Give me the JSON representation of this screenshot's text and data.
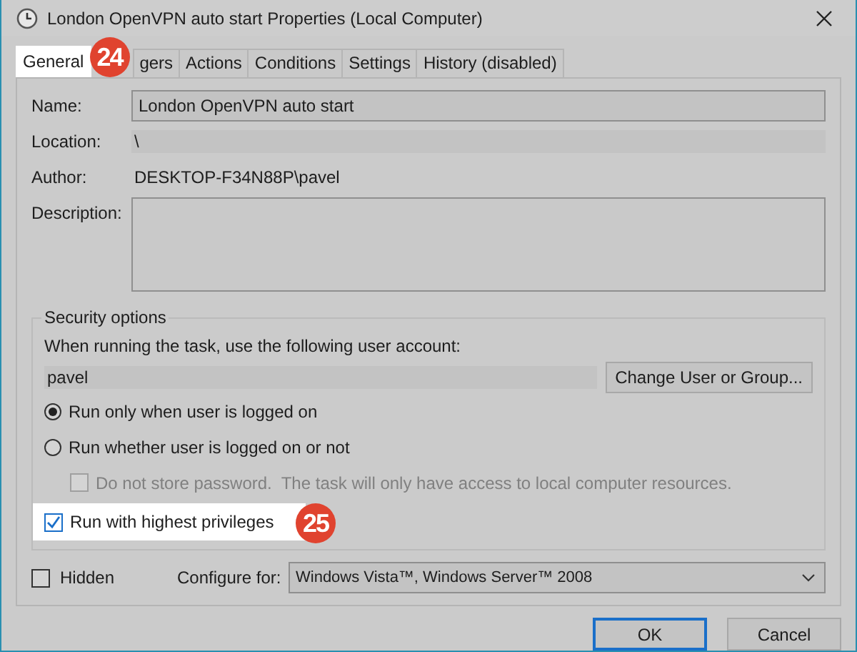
{
  "window": {
    "title": "London OpenVPN auto start Properties (Local Computer)"
  },
  "tabs": [
    {
      "label": "General",
      "selected": true,
      "highlighted": true,
      "badge": "24"
    },
    {
      "label": "gers",
      "selected": false,
      "highlighted": false
    },
    {
      "label": "Actions",
      "selected": false,
      "highlighted": false
    },
    {
      "label": "Conditions",
      "selected": false,
      "highlighted": false
    },
    {
      "label": "Settings",
      "selected": false,
      "highlighted": false
    },
    {
      "label": "History (disabled)",
      "selected": false,
      "highlighted": false
    }
  ],
  "fields": [
    {
      "kind": "input",
      "label": "Name:",
      "value": "London OpenVPN auto start"
    },
    {
      "kind": "readonly",
      "label": "Location:",
      "value": "\\"
    },
    {
      "kind": "text",
      "label": "Author:",
      "value": "DESKTOP-F34N88P\\pavel"
    },
    {
      "kind": "textarea",
      "label": "Description:"
    }
  ],
  "security": {
    "title": "Security options",
    "prompt": "When running the task, use the following user account:",
    "account": "pavel",
    "change_button": "Change User or Group...",
    "options": [
      {
        "label": "Run only when user is logged on",
        "selected": true
      },
      {
        "label": "Run whether user is logged on or not",
        "selected": false,
        "children": [
          {
            "label": "Do not store password.  The task will only have access to local computer resources.",
            "checked": false,
            "disabled": true
          }
        ]
      }
    ],
    "privileges": {
      "label": "Run with highest privileges",
      "checked": true,
      "highlighted": true,
      "badge": "25"
    }
  },
  "hidden": {
    "label": "Hidden",
    "checked": false
  },
  "configure": {
    "label": "Configure for:",
    "value": "Windows Vista™, Windows Server™ 2008"
  },
  "buttons": [
    {
      "label": "OK",
      "default": true
    },
    {
      "label": "Cancel",
      "default": false
    }
  ]
}
